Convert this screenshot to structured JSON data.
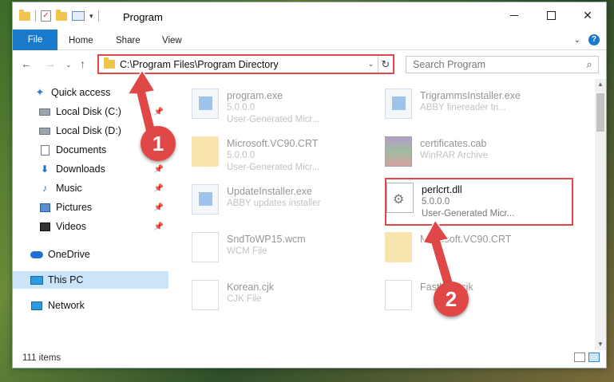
{
  "window": {
    "title": "Program",
    "quick_access_toolbar": {
      "icons": [
        "folder-icon",
        "properties-icon",
        "new-folder-icon",
        "customize-arrow-icon"
      ]
    }
  },
  "ribbon": {
    "tabs": [
      {
        "label": "File",
        "active": true
      },
      {
        "label": "Home"
      },
      {
        "label": "Share"
      },
      {
        "label": "View"
      }
    ],
    "help_label": "?"
  },
  "navigation": {
    "address": "C:\\Program Files\\Program Directory",
    "search_placeholder": "Search Program"
  },
  "sidebar": {
    "items": [
      {
        "label": "Quick access",
        "icon": "star-icon"
      },
      {
        "label": "Local Disk (C:)",
        "icon": "disk-icon",
        "pinned": true
      },
      {
        "label": "Local Disk (D:)",
        "icon": "disk-icon"
      },
      {
        "label": "Documents",
        "icon": "documents-icon"
      },
      {
        "label": "Downloads",
        "icon": "downloads-icon",
        "pinned": true
      },
      {
        "label": "Music",
        "icon": "music-icon",
        "pinned": true
      },
      {
        "label": "Pictures",
        "icon": "pictures-icon",
        "pinned": true
      },
      {
        "label": "Videos",
        "icon": "videos-icon",
        "pinned": true
      },
      {
        "label": "OneDrive",
        "icon": "cloud-icon"
      },
      {
        "label": "This PC",
        "icon": "computer-icon",
        "selected": true
      },
      {
        "label": "Network",
        "icon": "network-icon"
      }
    ]
  },
  "files": [
    {
      "name": "program.exe",
      "line1": "5.0.0.0",
      "line2": "User-Generated Micr...",
      "icon": "exe-icon"
    },
    {
      "name": "TrigrammsInstaller.exe",
      "line1": "ABBY finereader tri...",
      "line2": "",
      "icon": "exe-icon"
    },
    {
      "name": "Microsoft.VC90.CRT",
      "line1": "5.0.0.0",
      "line2": "User-Generated Micr...",
      "icon": "folder-icon"
    },
    {
      "name": "certificates.cab",
      "line1": "WinRAR Archive",
      "line2": "",
      "icon": "rar-icon"
    },
    {
      "name": "UpdateInstaller.exe",
      "line1": "ABBY updates installer",
      "line2": "",
      "icon": "exe-icon"
    },
    {
      "name": "perlcrt.dll",
      "line1": "5.0.0.0",
      "line2": "User-Generated Micr...",
      "icon": "dll-icon",
      "highlighted": true
    },
    {
      "name": "SndToWP15.wcm",
      "line1": "WCM File",
      "line2": "",
      "icon": "file-icon"
    },
    {
      "name": "Microsoft.VC90.CRT",
      "line1": "",
      "line2": "",
      "icon": "folder-icon"
    },
    {
      "name": "Korean.cjk",
      "line1": "CJK File",
      "line2": "",
      "icon": "file-icon"
    },
    {
      "name": "Fastleen.cjk",
      "line1": "",
      "line2": "",
      "icon": "file-icon"
    }
  ],
  "status": {
    "item_count": "111 items"
  },
  "callouts": [
    {
      "label": "1"
    },
    {
      "label": "2"
    }
  ],
  "colors": {
    "accent": "#1979ca",
    "highlight": "#e04848",
    "selected_bg": "#cce4f7"
  }
}
